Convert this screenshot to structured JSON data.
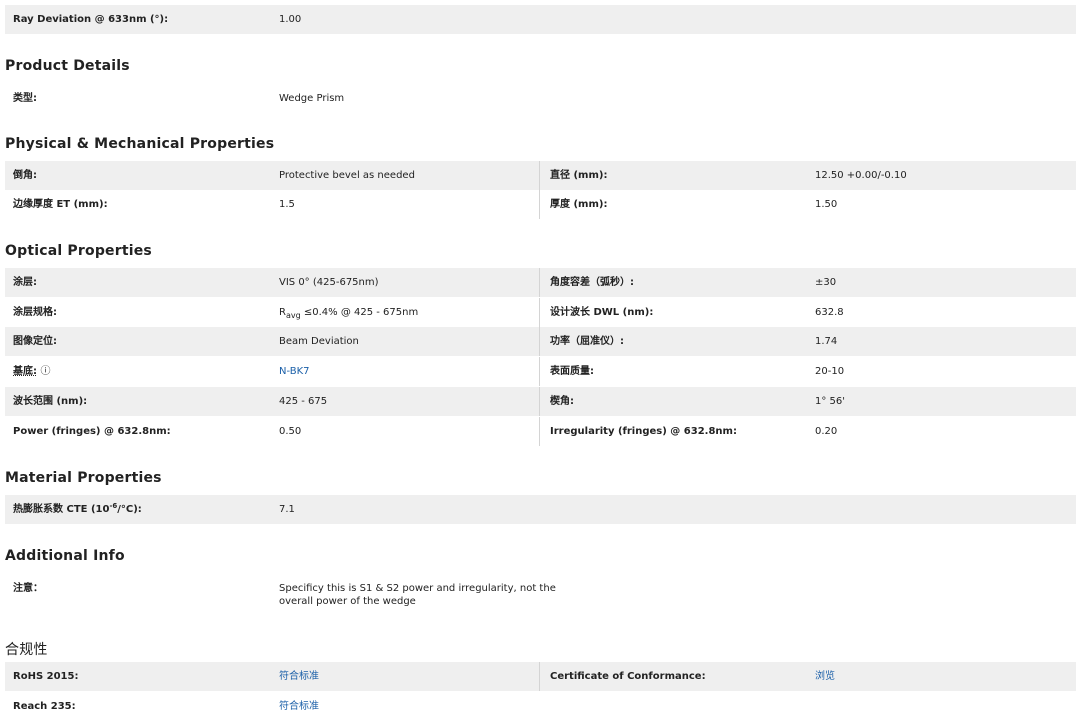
{
  "top_row": {
    "label": "Ray Deviation @ 633nm (°):",
    "value": "1.00"
  },
  "sections": {
    "product_details": "Product Details",
    "physical": "Physical & Mechanical Properties",
    "optical": "Optical Properties",
    "material": "Material Properties",
    "additional": "Additional Info",
    "compliance": "合规性"
  },
  "product_details": {
    "label": "类型:",
    "value": "Wedge Prism"
  },
  "physical": [
    {
      "l1": "倒角:",
      "v1": "Protective bevel as needed",
      "l2": "直径 (mm):",
      "v2": "12.50 +0.00/-0.10"
    },
    {
      "l1": "边缘厚度 ET (mm):",
      "v1": "1.5",
      "l2": "厚度 (mm):",
      "v2": "1.50"
    }
  ],
  "optical": {
    "coating_label": "涂层:",
    "coating_value": "VIS 0° (425-675nm)",
    "angle_tol_label": "角度容差（弧秒）:",
    "angle_tol_value": "±30",
    "coating_spec_label": "涂层规格:",
    "coating_spec_R": "R",
    "coating_spec_sub": "avg",
    "coating_spec_rest": " ≤0.4% @ 425 - 675nm",
    "dwl_label": "设计波长 DWL (nm):",
    "dwl_value": "632.8",
    "image_label": "图像定位:",
    "image_value": "Beam Deviation",
    "power_label": "功率（屈准仪）:",
    "power_value": "1.74",
    "substrate_label": "基底:",
    "substrate_info": "ⓘ",
    "substrate_value": "N-BK7",
    "surface_label": "表面质量:",
    "surface_value": "20-10",
    "wavelength_label": "波长范围 (nm):",
    "wavelength_value": "425 - 675",
    "wedge_label": "楔角:",
    "wedge_value": "1° 56'",
    "fringes_label": "Power (fringes) @ 632.8nm:",
    "fringes_value": "0.50",
    "irregularity_label": "Irregularity (fringes) @ 632.8nm:",
    "irregularity_value": "0.20"
  },
  "material": {
    "label_pre": "热膨胀系数 CTE (10",
    "label_sup": "-6",
    "label_post": "/°C):",
    "value": "7.1"
  },
  "additional": {
    "label": "注意：",
    "value_line1": "Specificy this is S1 & S2 power and irregularity, not the",
    "value_line2": "overall power of the wedge"
  },
  "compliance": {
    "rohs_label": "RoHS 2015:",
    "rohs_value": "符合标准",
    "coc_label": "Certificate of Conformance:",
    "coc_value": "浏览",
    "reach_label": "Reach 235:",
    "reach_value": "符合标准"
  },
  "colors": {
    "link": "#1a5fa8",
    "row_shade": "#efefef",
    "text": "#222222"
  }
}
